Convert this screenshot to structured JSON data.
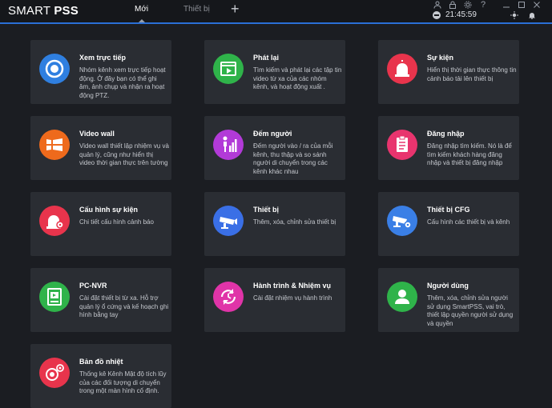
{
  "app": {
    "logo_light": "SMART ",
    "logo_bold": "PSS",
    "tabs": [
      {
        "label": "Mới",
        "active": true
      },
      {
        "label": "Thiết bị",
        "active": false
      }
    ],
    "add_tab": "+",
    "clock": "21:45:59",
    "accent": "#2a6fd6"
  },
  "cards": [
    {
      "title": "Xem trực tiếp",
      "desc": "Nhóm kênh xem trực tiếp hoạt động. Ở đây bạn có thể ghi âm, ảnh chụp và nhận ra hoạt động PTZ.",
      "icon": "live-view-icon",
      "color": "#2f7fe0"
    },
    {
      "title": "Phát lại",
      "desc": "Tìm kiếm và phát lại các tập tin video từ xa của các nhóm kênh, và hoạt động xuất .",
      "icon": "playback-icon",
      "color": "#2fb34a"
    },
    {
      "title": "Sự kiện",
      "desc": "Hiển thị thời gian thực thông tin cảnh báo tải lên thiết bị",
      "icon": "alarm-event-icon",
      "color": "#e8344c"
    },
    {
      "title": "Video wall",
      "desc": "Video wall thiết lập nhiệm vụ và quản lý, cũng như hiển thị video thời gian thực trên tường",
      "icon": "video-wall-icon",
      "color": "#ee6a1c"
    },
    {
      "title": "Đếm người",
      "desc": "Đếm người vào / ra của mỗi kênh, thu thập và so sánh người di chuyển trong các kênh khác nhau",
      "icon": "people-counting-icon",
      "color": "#b23ad8"
    },
    {
      "title": "Đăng nhập",
      "desc": "Đăng nhập tìm kiếm. Nó là để tìm kiếm khách hàng đăng nhập và thiết bị đăng nhập",
      "icon": "log-clipboard-icon",
      "color": "#e8346e"
    },
    {
      "title": "Cấu hình sự kiện",
      "desc": "Chi tiết cấu hình cảnh báo",
      "icon": "event-config-icon",
      "color": "#e8344c"
    },
    {
      "title": "Thiết bị",
      "desc": "Thêm, xóa, chỉnh sửa thiết bị",
      "icon": "camera-device-icon",
      "color": "#3a6fe6"
    },
    {
      "title": "Thiết bị CFG",
      "desc": "Cấu hình các thiết bị và kênh",
      "icon": "camera-config-icon",
      "color": "#3a7fe6"
    },
    {
      "title": "PC-NVR",
      "desc": "Cài đặt thiết bị từ xa. Hỗ trợ quản lý ổ cứng và kế hoạch ghi hình bằng tay",
      "icon": "pc-nvr-icon",
      "color": "#2fb34a"
    },
    {
      "title": "Hành trình & Nhiệm vụ",
      "desc": "Cài đặt nhiệm vụ hành trình",
      "icon": "tour-task-icon",
      "color": "#e034a8"
    },
    {
      "title": "Người dùng",
      "desc": "Thêm, xóa, chỉnh sửa người sử dụng SmartPSS, vai trò, thiết lập quyền người sử dụng và quyền",
      "icon": "user-icon",
      "color": "#2fb34a"
    },
    {
      "title": "Bản đồ nhiệt",
      "desc": "Thống kê Kênh Mật độ tích lũy của các đối tượng di chuyển trong một màn hình cố định.",
      "icon": "heat-map-icon",
      "color": "#e8344c"
    }
  ]
}
